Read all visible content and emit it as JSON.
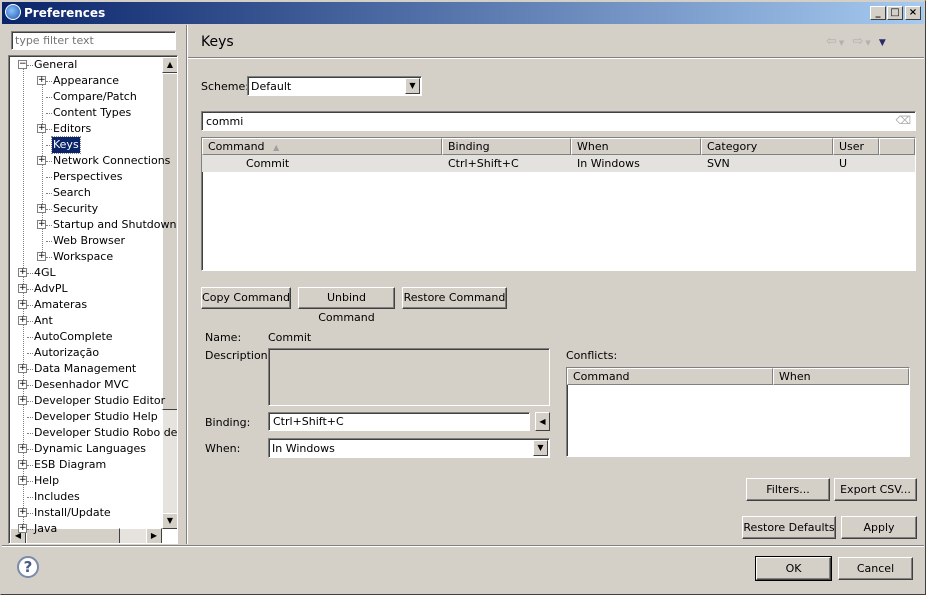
{
  "window": {
    "title": "Preferences",
    "minimize": "_",
    "maximize": "□",
    "close": "×"
  },
  "filter": {
    "placeholder": "type filter text",
    "value": ""
  },
  "tree": [
    {
      "label": "General",
      "level": 0,
      "expander": "minus"
    },
    {
      "label": "Appearance",
      "level": 1,
      "expander": "plus"
    },
    {
      "label": "Compare/Patch",
      "level": 1,
      "expander": "none"
    },
    {
      "label": "Content Types",
      "level": 1,
      "expander": "none"
    },
    {
      "label": "Editors",
      "level": 1,
      "expander": "plus"
    },
    {
      "label": "Keys",
      "level": 1,
      "expander": "none",
      "selected": true
    },
    {
      "label": "Network Connections",
      "level": 1,
      "expander": "plus"
    },
    {
      "label": "Perspectives",
      "level": 1,
      "expander": "none"
    },
    {
      "label": "Search",
      "level": 1,
      "expander": "none"
    },
    {
      "label": "Security",
      "level": 1,
      "expander": "plus"
    },
    {
      "label": "Startup and Shutdown",
      "level": 1,
      "expander": "plus"
    },
    {
      "label": "Web Browser",
      "level": 1,
      "expander": "none"
    },
    {
      "label": "Workspace",
      "level": 1,
      "expander": "plus"
    },
    {
      "label": "4GL",
      "level": 0,
      "expander": "plus"
    },
    {
      "label": "AdvPL",
      "level": 0,
      "expander": "plus"
    },
    {
      "label": "Amateras",
      "level": 0,
      "expander": "plus"
    },
    {
      "label": "Ant",
      "level": 0,
      "expander": "plus"
    },
    {
      "label": "AutoComplete",
      "level": 0,
      "expander": "none"
    },
    {
      "label": "Autorização",
      "level": 0,
      "expander": "none"
    },
    {
      "label": "Data Management",
      "level": 0,
      "expander": "plus"
    },
    {
      "label": "Desenhador MVC",
      "level": 0,
      "expander": "plus"
    },
    {
      "label": "Developer Studio Editor",
      "level": 0,
      "expander": "plus"
    },
    {
      "label": "Developer Studio Help",
      "level": 0,
      "expander": "none"
    },
    {
      "label": "Developer Studio Robo de",
      "level": 0,
      "expander": "none"
    },
    {
      "label": "Dynamic Languages",
      "level": 0,
      "expander": "plus"
    },
    {
      "label": "ESB Diagram",
      "level": 0,
      "expander": "plus"
    },
    {
      "label": "Help",
      "level": 0,
      "expander": "plus"
    },
    {
      "label": "Includes",
      "level": 0,
      "expander": "none"
    },
    {
      "label": "Install/Update",
      "level": 0,
      "expander": "plus"
    },
    {
      "label": "Java",
      "level": 0,
      "expander": "plus"
    }
  ],
  "page": {
    "title": "Keys"
  },
  "scheme": {
    "label": "Scheme:",
    "value": "Default"
  },
  "search": {
    "value": "commi"
  },
  "table": {
    "columns": [
      "Command",
      "Binding",
      "When",
      "Category",
      "User"
    ],
    "rows": [
      {
        "command": "Commit",
        "binding": "Ctrl+Shift+C",
        "when": "In Windows",
        "category": "SVN",
        "user": "U"
      }
    ]
  },
  "buttons": {
    "copy": "Copy Command",
    "unbind": "Unbind Command",
    "restore": "Restore Command",
    "filters": "Filters...",
    "export": "Export CSV...",
    "restore_defaults": "Restore Defaults",
    "apply": "Apply",
    "ok": "OK",
    "cancel": "Cancel"
  },
  "details": {
    "name_label": "Name:",
    "name_value": "Commit",
    "description_label": "Description:",
    "description_value": "",
    "binding_label": "Binding:",
    "binding_value": "Ctrl+Shift+C",
    "when_label": "When:",
    "when_value": "In Windows",
    "conflicts_label": "Conflicts:",
    "conflict_columns": [
      "Command",
      "When"
    ]
  },
  "colors": {
    "title_bar": "#0a246a",
    "selection": "#0a246a",
    "background": "#d4d0c8"
  }
}
